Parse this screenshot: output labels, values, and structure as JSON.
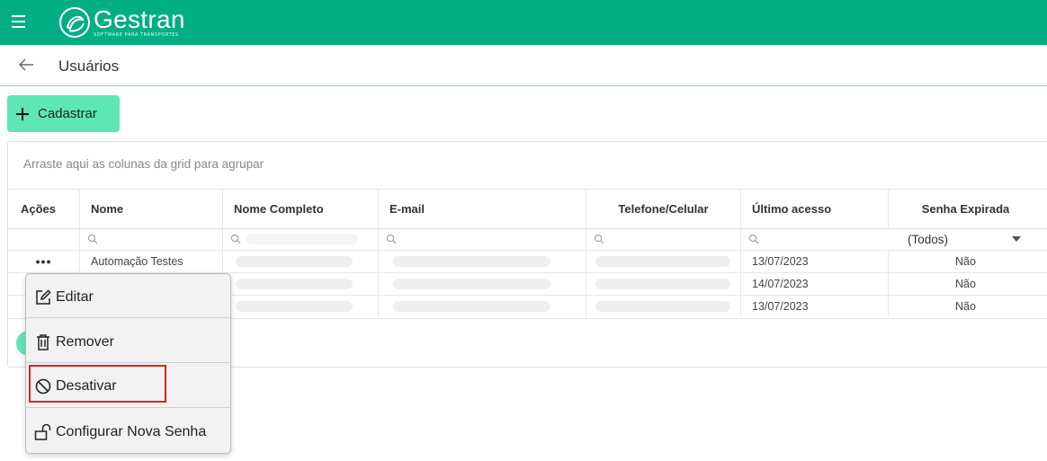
{
  "app": {
    "brand_name": "Gestran",
    "brand_tagline": "SOFTWARE PARA TRANSPORTES",
    "brand_color": "#00ae84",
    "accent_color": "#5ee6b6"
  },
  "page": {
    "title": "Usuários"
  },
  "toolbar": {
    "add_label": "Cadastrar"
  },
  "grid": {
    "group_hint": "Arraste aqui as colunas da grid para agrupar",
    "columns": [
      "Ações",
      "Nome",
      "Nome Completo",
      "E-mail",
      "Telefone/Celular",
      "Último acesso",
      "Senha Expirada"
    ],
    "filter_select_value": "(Todos)",
    "rows": [
      {
        "actions": "•••",
        "nome": "Automação Testes",
        "ultimo_acesso": "13/07/2023",
        "senha_expirada": "Não"
      },
      {
        "actions": "",
        "nome": "",
        "ultimo_acesso": "14/07/2023",
        "senha_expirada": "Não"
      },
      {
        "actions": "",
        "nome": "",
        "ultimo_acesso": "13/07/2023",
        "senha_expirada": "Não"
      }
    ]
  },
  "context_menu": {
    "items": [
      {
        "label": "Editar",
        "icon": "edit-icon"
      },
      {
        "label": "Remover",
        "icon": "trash-icon"
      },
      {
        "label": "Desativar",
        "icon": "ban-icon"
      },
      {
        "label": "Configurar Nova Senha",
        "icon": "unlock-icon"
      }
    ],
    "highlight_color": "#e32020"
  }
}
